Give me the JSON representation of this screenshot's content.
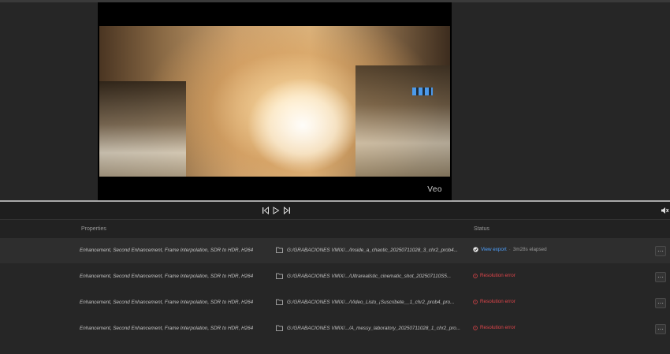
{
  "preview": {
    "watermark": "Veo"
  },
  "transport": {
    "prev_icon": "skip-previous-icon",
    "play_icon": "play-icon",
    "next_icon": "skip-next-icon",
    "volume_icon": "volume-icon"
  },
  "table": {
    "columns": {
      "properties": "Properties",
      "status": "Status"
    },
    "rows": [
      {
        "properties": "Enhancement, Second Enhancement, Frame Interpolation, SDR to HDR, H264",
        "path": "G:/GRABACIONES VMIX/.../Inside_a_chaotic_20250711028_3_chr2_prob4...",
        "status_link": "View export",
        "status_sep": "·",
        "status_elapsed": "3m28s elapsed",
        "more": "···"
      },
      {
        "properties": "Enhancement, Second Enhancement, Frame Interpolation, SDR to HDR, H264",
        "path": "G:/GRABACIONES VMIX/.../Ultrarealistic_cinematic_shot_202507110S5...",
        "status_error": "Resolution error",
        "more": "···"
      },
      {
        "properties": "Enhancement, Second Enhancement, Frame Interpolation, SDR to HDR, H264",
        "path": "G:/GRABACIONES VMIX/.../Video_Listo_¡Suscribete__1_chr2_prob4_pro...",
        "status_error": "Resolution error",
        "more": "···"
      },
      {
        "properties": "Enhancement, Second Enhancement, Frame Interpolation, SDR to HDR, H264",
        "path": "G:/GRABACIONES VMIX/.../A_messy_laboratory_20250711028_1_chr2_pro...",
        "status_error": "Resolution error",
        "more": "···"
      }
    ]
  },
  "colors": {
    "link": "#4ea1ff",
    "error": "#e0454a",
    "background": "#262626"
  }
}
